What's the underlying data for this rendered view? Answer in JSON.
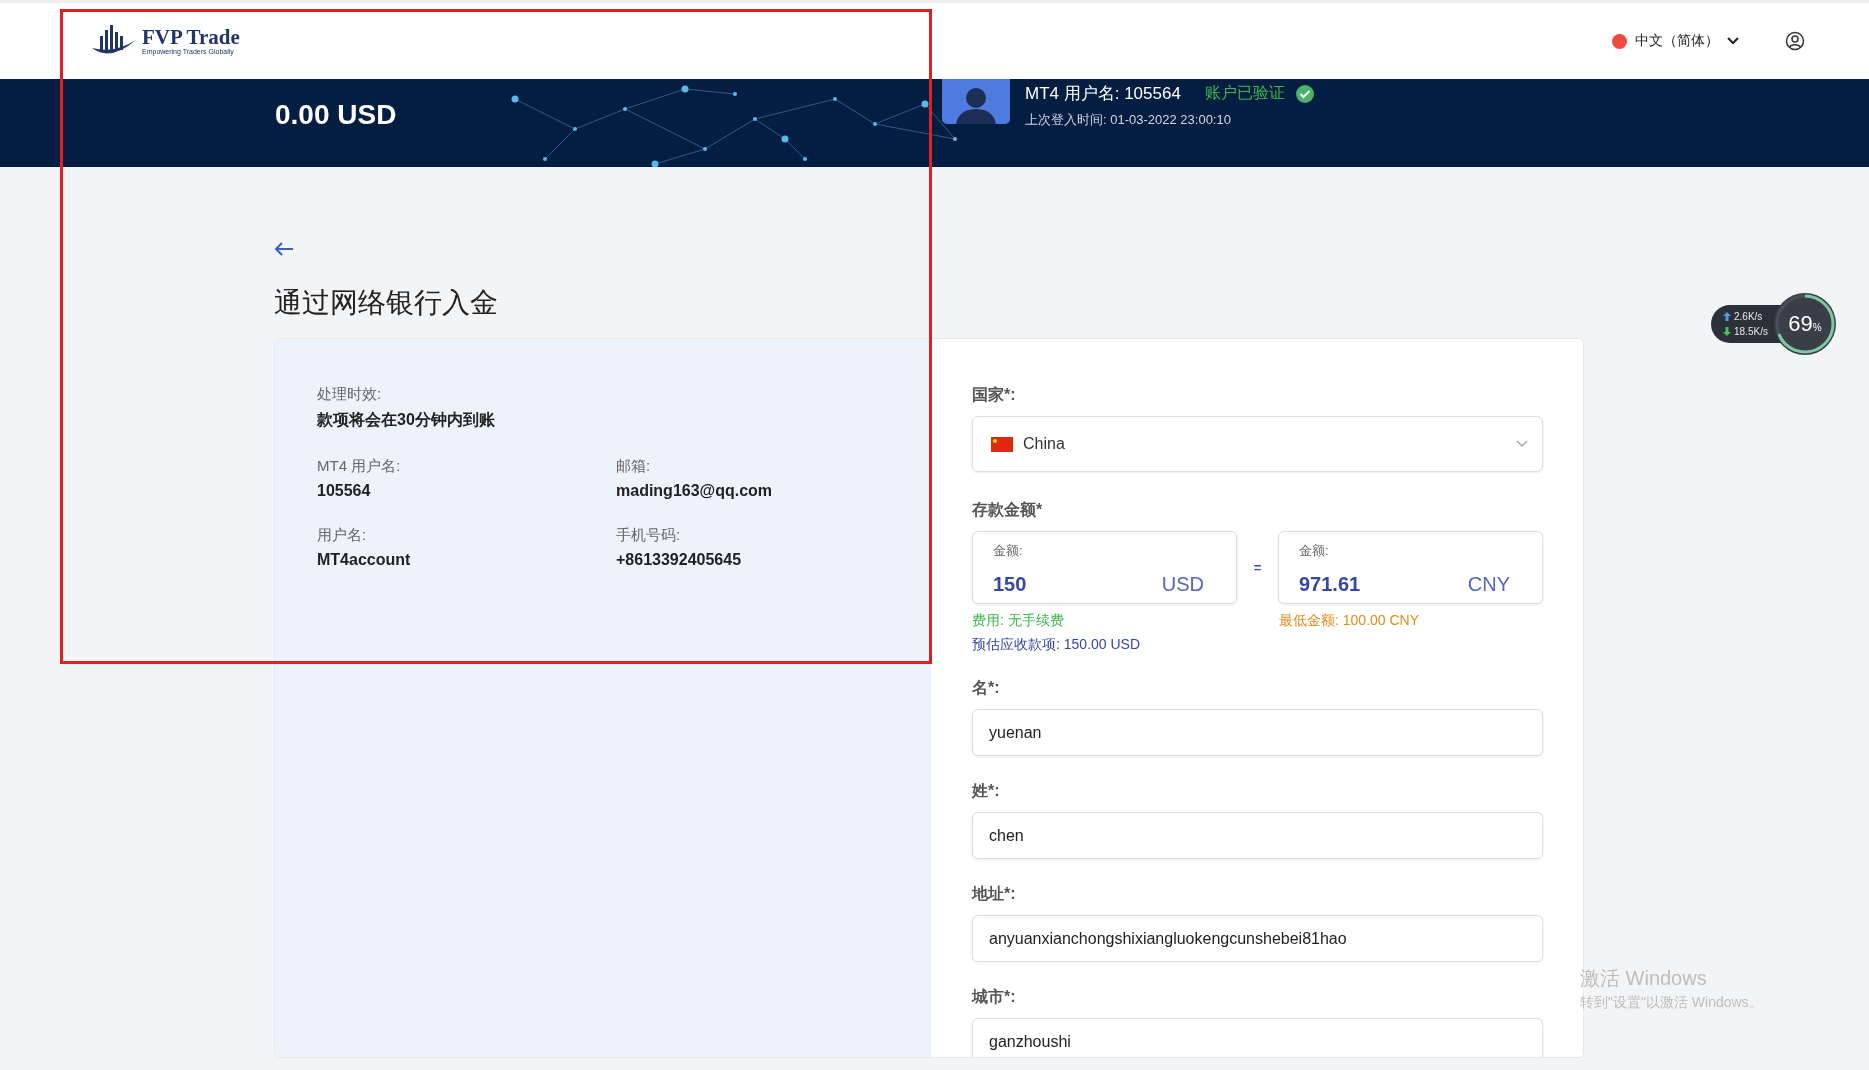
{
  "header": {
    "logo": {
      "name": "FVP Trade",
      "tagline": "Empowering Traders Globally"
    },
    "language": {
      "label": "中文（简体）",
      "color": "#f04a3e"
    }
  },
  "banner": {
    "balance": "0.00 USD",
    "account": {
      "username_label": "MT4 用户名:",
      "username": "105564",
      "verified": true,
      "verified_label": "账户已验证",
      "last_login": "上次登入时间: 01-03-2022 23:00:10"
    }
  },
  "page": {
    "title": "通过网络银行入金"
  },
  "info": {
    "processing": {
      "label": "处理时效:",
      "value": "款项将会在30分钟内到账"
    },
    "fields": [
      {
        "label": "MT4 用户名:",
        "value": "105564"
      },
      {
        "label": "邮箱:",
        "value": "mading163@qq.com"
      },
      {
        "label": "用户名:",
        "value": "MT4account"
      },
      {
        "label": "手机号码:",
        "value": "+8613392405645"
      }
    ]
  },
  "form": {
    "country": {
      "label": "国家*:",
      "value": "China"
    },
    "amount": {
      "label": "存款金额*",
      "from": {
        "label": "金额:",
        "value": "150",
        "currency": "USD"
      },
      "equals": "=",
      "to": {
        "label": "金额:",
        "value": "971.61",
        "currency": "CNY"
      },
      "fee": "费用: 无手续费",
      "minimum": "最低金额: 100.00 CNY",
      "estimate": {
        "label": "预估应收款项:",
        "value": "150.00 USD"
      }
    },
    "fields": [
      {
        "label": "名*:",
        "value": "yuenan"
      },
      {
        "label": "姓*:",
        "value": "chen"
      },
      {
        "label": "地址*:",
        "value": "anyuanxianchongshixiangluokengcunshebei81hao"
      },
      {
        "label": "城市*:",
        "value": "ganzhoushi"
      }
    ]
  },
  "net_widget": {
    "upload": "2.6K/s",
    "download": "18.5K/s",
    "usage": "69",
    "unit": "%"
  },
  "activation": {
    "title": "激活 Windows",
    "subtitle": "转到\"设置\"以激活 Windows。"
  }
}
